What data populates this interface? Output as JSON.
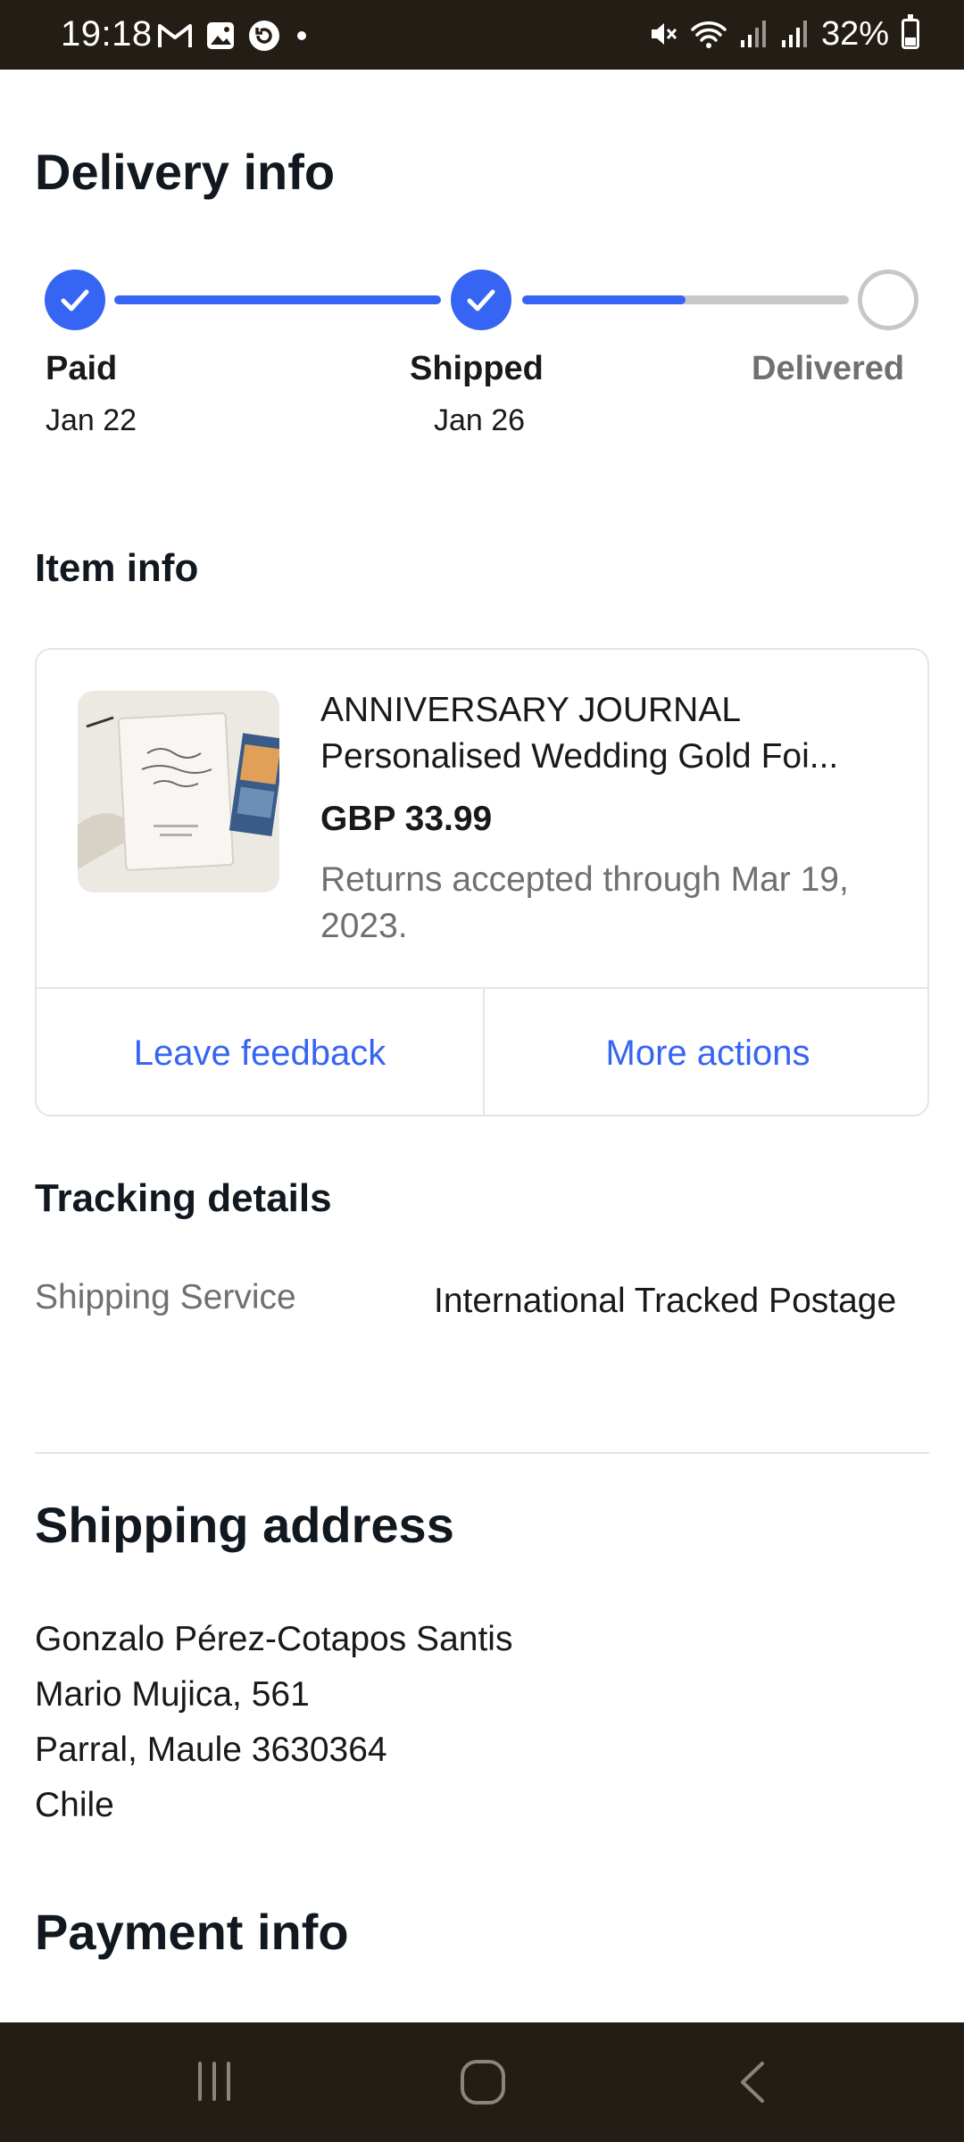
{
  "status_bar": {
    "time": "19:18",
    "battery": "32%",
    "battery_level": 0.32,
    "left_icons": [
      "gmail-icon",
      "gallery-icon",
      "sync-icon",
      "dot-icon"
    ],
    "right_icons": [
      "mute-icon",
      "wifi-icon",
      "signal-icon",
      "signal-icon",
      "battery-icon"
    ]
  },
  "delivery": {
    "title": "Delivery info",
    "steps": [
      {
        "label": "Paid",
        "date": "Jan 22",
        "status": "done"
      },
      {
        "label": "Shipped",
        "date": "Jan 26",
        "status": "done"
      },
      {
        "label": "Delivered",
        "date": "",
        "status": "pending"
      }
    ],
    "progress_to_delivered": 0.5,
    "colors": {
      "active": "#3665f3",
      "inactive": "#c7c7c7",
      "pending_text": "#707070"
    }
  },
  "item": {
    "section_title": "Item info",
    "title_line1": "ANNIVERSARY JOURNAL",
    "title_line2": "Personalised Wedding Gold Foi...",
    "price": "GBP 33.99",
    "returns": "Returns accepted through Mar 19, 2023.",
    "actions": {
      "feedback": "Leave feedback",
      "more": "More actions"
    }
  },
  "tracking": {
    "title": "Tracking details",
    "label": "Shipping Service",
    "value": "International Tracked Postage"
  },
  "shipping": {
    "title": "Shipping address",
    "lines": [
      "Gonzalo Pérez-Cotapos Santis",
      "Mario Mujica, 561",
      "Parral, Maule 3630364",
      "Chile"
    ]
  },
  "payment": {
    "title": "Payment info"
  },
  "nav": {
    "icons": [
      "recent-apps-icon",
      "home-icon",
      "back-icon"
    ]
  }
}
